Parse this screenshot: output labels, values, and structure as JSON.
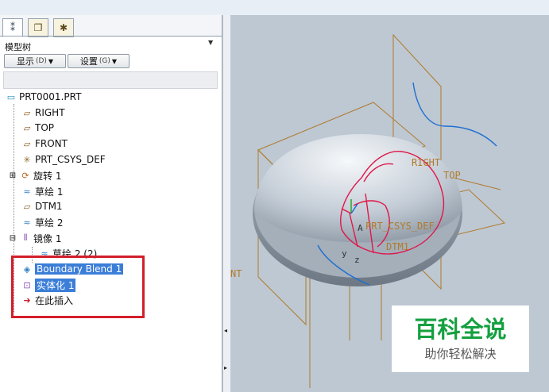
{
  "panel": {
    "title": "模型树",
    "menu_arrow": "▼",
    "tab_icons": [
      "model-tree-tab-icon",
      "folder-tab-icon",
      "favorites-tab-icon"
    ],
    "buttons": [
      {
        "label": "显示",
        "shortcut": "(D)",
        "arrow": "▼"
      },
      {
        "label": "设置",
        "shortcut": "(G)",
        "arrow": "▼"
      }
    ]
  },
  "tree": {
    "items": [
      {
        "label": "PRT0001.PRT",
        "icon": "part-icon",
        "icon_glyph": "▭",
        "icon_color": "#2a8fc2"
      },
      {
        "label": "RIGHT",
        "icon": "datum-plane-icon",
        "icon_glyph": "▱",
        "icon_color": "#8b5a1a"
      },
      {
        "label": "TOP",
        "icon": "datum-plane-icon",
        "icon_glyph": "▱",
        "icon_color": "#8b5a1a"
      },
      {
        "label": "FRONT",
        "icon": "datum-plane-icon",
        "icon_glyph": "▱",
        "icon_color": "#8b5a1a"
      },
      {
        "label": "PRT_CSYS_DEF",
        "icon": "csys-icon",
        "icon_glyph": "✳",
        "icon_color": "#8b6a2a"
      },
      {
        "label": "旋转 1",
        "icon": "revolve-icon",
        "icon_glyph": "⟳",
        "icon_color": "#b36b2a",
        "expander": "⊞"
      },
      {
        "label": "草绘 1",
        "icon": "sketch-icon",
        "icon_glyph": "≈",
        "icon_color": "#2a7cc2"
      },
      {
        "label": "DTM1",
        "icon": "datum-plane-icon",
        "icon_glyph": "▱",
        "icon_color": "#8b5a1a"
      },
      {
        "label": "草绘 2",
        "icon": "sketch-icon",
        "icon_glyph": "≈",
        "icon_color": "#2a7cc2"
      },
      {
        "label": "镜像 1",
        "icon": "mirror-icon",
        "icon_glyph": "⫴",
        "icon_color": "#8a4fb3",
        "expander": "⊟"
      },
      {
        "label": "草绘 2 (2)",
        "icon": "sketch-icon",
        "icon_glyph": "≈",
        "icon_color": "#2a7cc2"
      },
      {
        "label": "Boundary Blend 1",
        "icon": "boundary-blend-icon",
        "icon_glyph": "◈",
        "icon_color": "#2a7cc2",
        "selected": true
      },
      {
        "label": "实体化 1",
        "icon": "solidify-icon",
        "icon_glyph": "⊡",
        "icon_color": "#8a4fb3",
        "selected": true
      },
      {
        "label": "在此插入",
        "icon": "insert-here-arrow-icon",
        "icon_glyph": "➜",
        "icon_color": "#c8202a"
      }
    ]
  },
  "viewport": {
    "labels": {
      "right": "RIGHT",
      "top": "TOP",
      "csys": "PRT_CSYS_DEF",
      "dtm1": "DTM1",
      "front_fragment": "NT",
      "axis_a": "A",
      "axis_z": "z",
      "axis_y": "y"
    },
    "colors": {
      "datum": "#b07a2a",
      "highlight": "#e0174a",
      "sketch": "#1f6fd0",
      "body": "#c6d0da"
    }
  },
  "divider": {
    "collapse_arrow": "◂",
    "expand_arrow": "▸"
  },
  "watermark": {
    "title": "百科全说",
    "subtitle": "助你轻松解决"
  }
}
